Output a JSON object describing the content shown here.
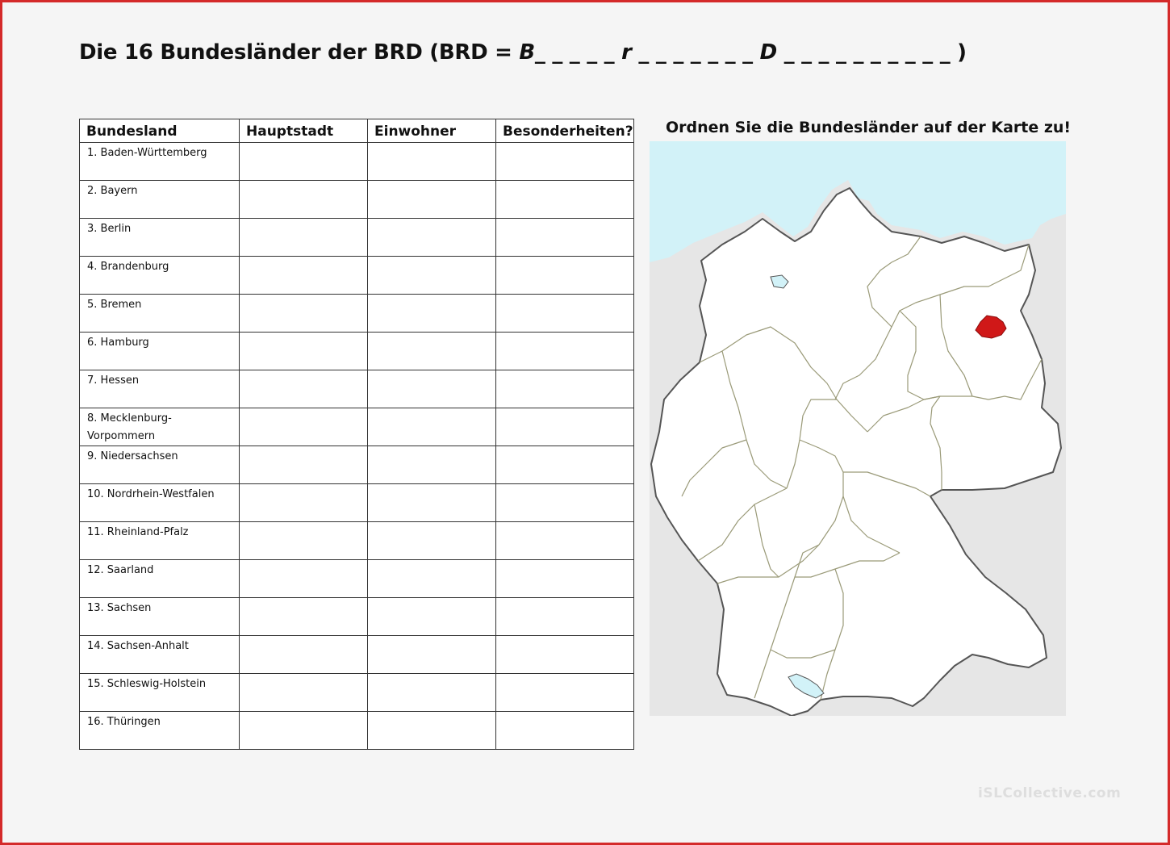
{
  "title": {
    "prefix": "Die 16 Bundesländer der BRD (BRD = ",
    "letter_b": "B",
    "blank_1": "_ _ _ _ _ ",
    "letter_r": "r",
    "blank_2": " _ _ _ _ _ _ _ ",
    "letter_d": "D",
    "blank_3": " _ _ _ _ _ _ _ _ _ _ ",
    "suffix": ")"
  },
  "table": {
    "headers": [
      "Bundesland",
      "Hauptstadt",
      "Einwohner",
      "Besonderheiten?"
    ],
    "rows": [
      {
        "name": "1. Baden-Württemberg"
      },
      {
        "name": "2. Bayern"
      },
      {
        "name": "3. Berlin"
      },
      {
        "name": "4. Brandenburg"
      },
      {
        "name": "5. Bremen"
      },
      {
        "name": "6. Hamburg"
      },
      {
        "name": "7. Hessen"
      },
      {
        "name": "8. Mecklenburg-Vorpommern"
      },
      {
        "name": "9. Niedersachsen"
      },
      {
        "name": "10. Nordrhein-Westfalen"
      },
      {
        "name": "11. Rheinland-Pfalz"
      },
      {
        "name": "12. Saarland"
      },
      {
        "name": "13. Sachsen"
      },
      {
        "name": "14. Sachsen-Anhalt"
      },
      {
        "name": "15. Schleswig-Holstein"
      },
      {
        "name": "16. Thüringen"
      }
    ]
  },
  "map": {
    "heading": "Ordnen Sie die Bundesländer auf der Karte zu!",
    "colors": {
      "sea": "#d2f2f8",
      "neighbour": "#e6e6e6",
      "germany": "#ffffff",
      "border_outer": "#555555",
      "border_inner": "#9a9a78",
      "highlight": "#d01818"
    },
    "highlighted_state": "Berlin"
  },
  "watermark": "iSLCollective.com",
  "colors": {
    "frame": "#d42a2a",
    "page": "#f5f5f5"
  }
}
